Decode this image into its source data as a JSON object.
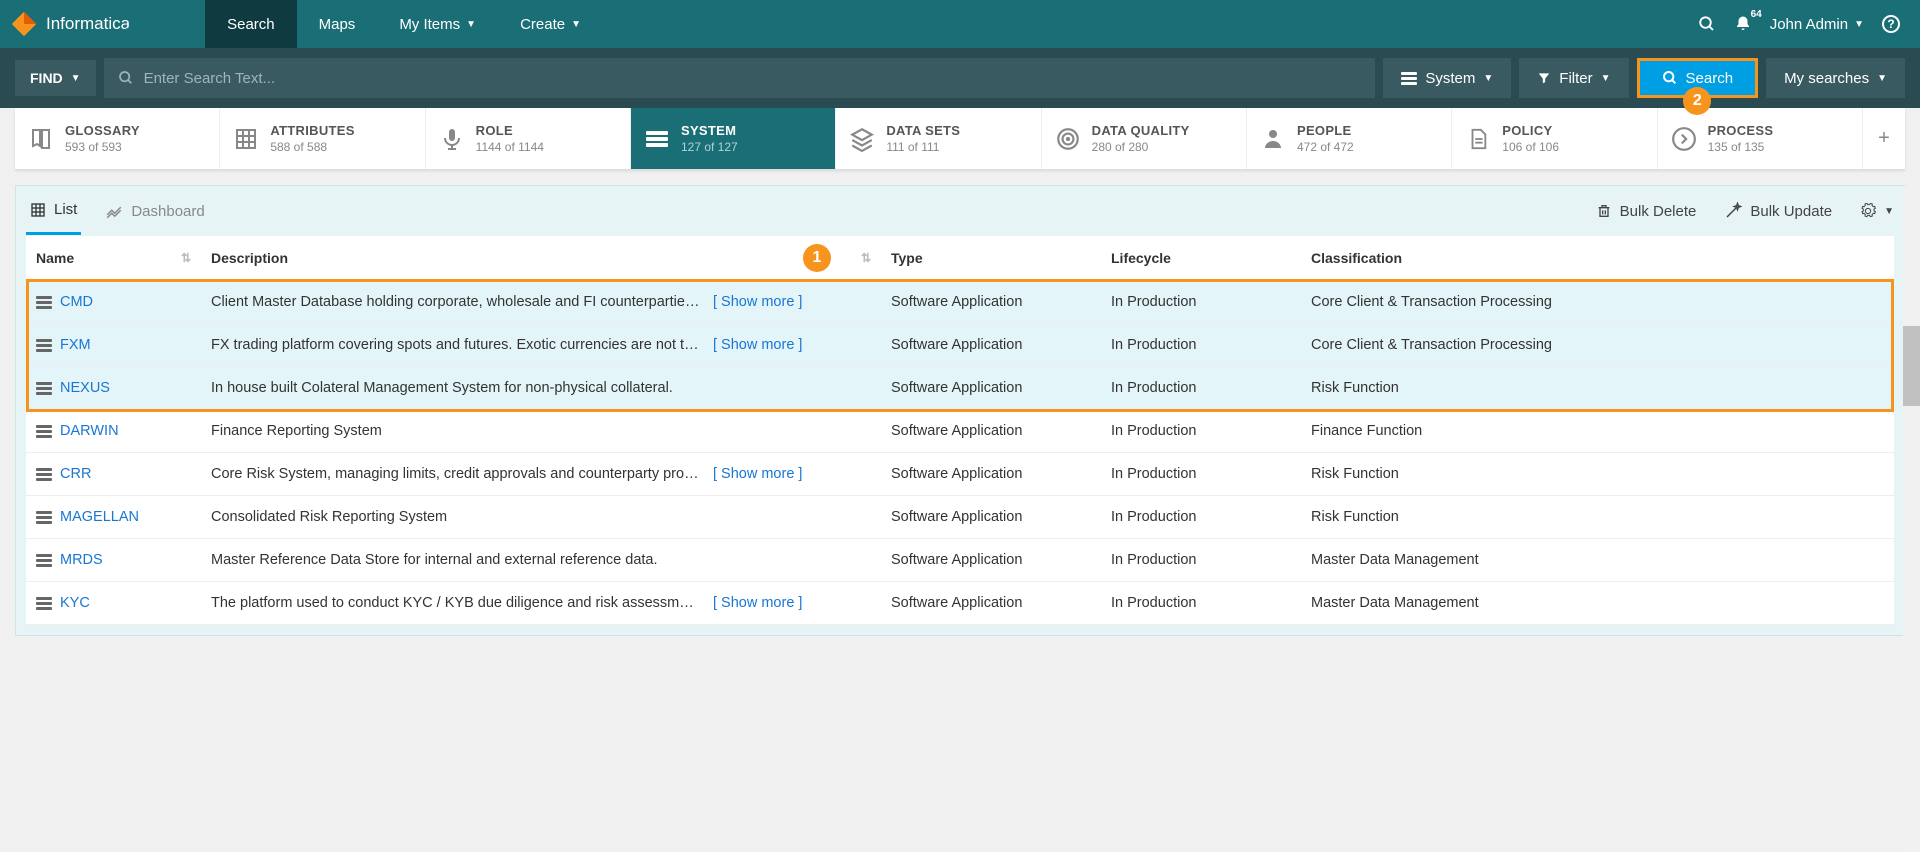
{
  "brand": "Informatica",
  "topnav": {
    "tabs": [
      {
        "label": "Search",
        "active": true,
        "hasCaret": false
      },
      {
        "label": "Maps",
        "active": false,
        "hasCaret": false
      },
      {
        "label": "My Items",
        "active": false,
        "hasCaret": true
      },
      {
        "label": "Create",
        "active": false,
        "hasCaret": true
      }
    ],
    "badge": "64",
    "user": "John Admin"
  },
  "searchbar": {
    "find": "FIND",
    "placeholder": "Enter Search Text...",
    "systemBtn": "System",
    "filterBtn": "Filter",
    "searchBtn": "Search",
    "mySearches": "My searches"
  },
  "categories": [
    {
      "label": "GLOSSARY",
      "count": "593 of 593",
      "icon": "book"
    },
    {
      "label": "ATTRIBUTES",
      "count": "588 of 588",
      "icon": "grid"
    },
    {
      "label": "ROLE",
      "count": "1144 of 1144",
      "icon": "mic"
    },
    {
      "label": "SYSTEM",
      "count": "127 of 127",
      "icon": "stack",
      "active": true
    },
    {
      "label": "DATA SETS",
      "count": "111 of 111",
      "icon": "layers"
    },
    {
      "label": "DATA QUALITY",
      "count": "280 of 280",
      "icon": "target"
    },
    {
      "label": "PEOPLE",
      "count": "472 of 472",
      "icon": "person"
    },
    {
      "label": "POLICY",
      "count": "106 of 106",
      "icon": "doc"
    },
    {
      "label": "PROCESS",
      "count": "135 of 135",
      "icon": "next"
    }
  ],
  "views": {
    "list": "List",
    "dashboard": "Dashboard"
  },
  "toolbar": {
    "bulkDelete": "Bulk Delete",
    "bulkUpdate": "Bulk Update"
  },
  "columns": {
    "name": "Name",
    "description": "Description",
    "type": "Type",
    "lifecycle": "Lifecycle",
    "classification": "Classification"
  },
  "showMore": "[ Show more ]",
  "numCircle1": "1",
  "numCircle2": "2",
  "rows": [
    {
      "name": "CMD",
      "desc": "Client Master Database holding corporate, wholesale and FI counterparties. Some...",
      "showMore": true,
      "type": "Software Application",
      "life": "In Production",
      "class": "Core Client & Transaction Processing",
      "sel": true
    },
    {
      "name": "FXM",
      "desc": "FX trading platform covering spots and futures. Exotic currencies are not trade...",
      "showMore": true,
      "type": "Software Application",
      "life": "In Production",
      "class": "Core Client & Transaction Processing",
      "sel": true
    },
    {
      "name": "NEXUS",
      "desc": "In house built Colateral Management System for non-physical collateral.",
      "showMore": false,
      "type": "Software Application",
      "life": "In Production",
      "class": "Risk Function",
      "sel": true
    },
    {
      "name": "DARWIN",
      "desc": "Finance Reporting System",
      "showMore": false,
      "type": "Software Application",
      "life": "In Production",
      "class": "Finance Function",
      "sel": false
    },
    {
      "name": "CRR",
      "desc": "Core Risk System, managing limits, credit approvals and counterparty probabiliti...",
      "showMore": true,
      "type": "Software Application",
      "life": "In Production",
      "class": "Risk Function",
      "sel": false
    },
    {
      "name": "MAGELLAN",
      "desc": "Consolidated Risk Reporting System",
      "showMore": false,
      "type": "Software Application",
      "life": "In Production",
      "class": "Risk Function",
      "sel": false
    },
    {
      "name": "MRDS",
      "desc": "Master Reference Data Store for internal and external reference data.",
      "showMore": false,
      "type": "Software Application",
      "life": "In Production",
      "class": "Master Data Management",
      "sel": false
    },
    {
      "name": "KYC",
      "desc": "The platform used to conduct KYC / KYB due diligence and risk assessments, and ...",
      "showMore": true,
      "type": "Software Application",
      "life": "In Production",
      "class": "Master Data Management",
      "sel": false
    }
  ]
}
